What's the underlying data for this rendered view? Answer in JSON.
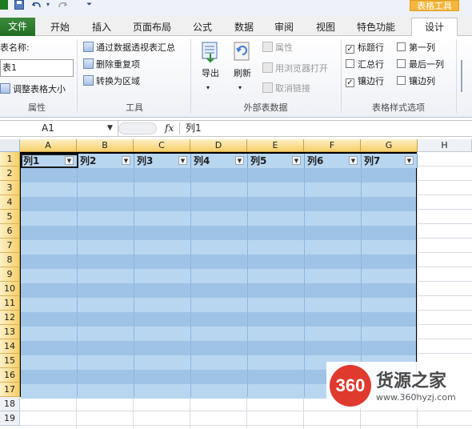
{
  "qat": {
    "excel_icon": "excel-icon",
    "save_icon": "save-icon",
    "undo_icon": "undo-icon",
    "redo_icon": "redo-icon",
    "customize_icon": "customize-icon"
  },
  "context_tab_group": "表格工具",
  "tabs": [
    "文件",
    "开始",
    "插入",
    "页面布局",
    "公式",
    "数据",
    "审阅",
    "视图",
    "特色功能",
    "设计"
  ],
  "ribbon": {
    "properties": {
      "table_name_label": "表名称:",
      "table_name_value": "表1",
      "resize_label": "调整表格大小",
      "group_label": "属性"
    },
    "tools": {
      "items": [
        "通过数据透视表汇总",
        "删除重复项",
        "转换为区域"
      ],
      "group_label": "工具"
    },
    "external": {
      "export_label": "导出",
      "refresh_label": "刷新",
      "items": [
        "属性",
        "用浏览器打开",
        "取消链接"
      ],
      "group_label": "外部表数据"
    },
    "style_options": {
      "options": [
        {
          "label": "标题行",
          "checked": true
        },
        {
          "label": "第一列",
          "checked": false
        },
        {
          "label": "汇总行",
          "checked": false
        },
        {
          "label": "最后一列",
          "checked": false
        },
        {
          "label": "镶边行",
          "checked": true
        },
        {
          "label": "镶边列",
          "checked": false
        }
      ],
      "group_label": "表格样式选项"
    }
  },
  "formula_bar": {
    "name_box": "A1",
    "fx": "fx",
    "value": "列1"
  },
  "sheet": {
    "columns": [
      "A",
      "B",
      "C",
      "D",
      "E",
      "F",
      "G",
      "H"
    ],
    "rows": [
      "1",
      "2",
      "3",
      "4",
      "5",
      "6",
      "7",
      "8",
      "9",
      "10",
      "11",
      "12",
      "13",
      "14",
      "15",
      "16",
      "17",
      "18",
      "19"
    ],
    "table_headers": [
      "列1",
      "列2",
      "列3",
      "列4",
      "列5",
      "列6",
      "列7"
    ],
    "colors": {
      "band_dark": "#9fc3e6",
      "band_light": "#b9d6f1",
      "header_highlight": "#f6cf68"
    }
  },
  "watermark": {
    "badge": "360",
    "title": "货源之家",
    "url": "www.360hyzj.com"
  }
}
